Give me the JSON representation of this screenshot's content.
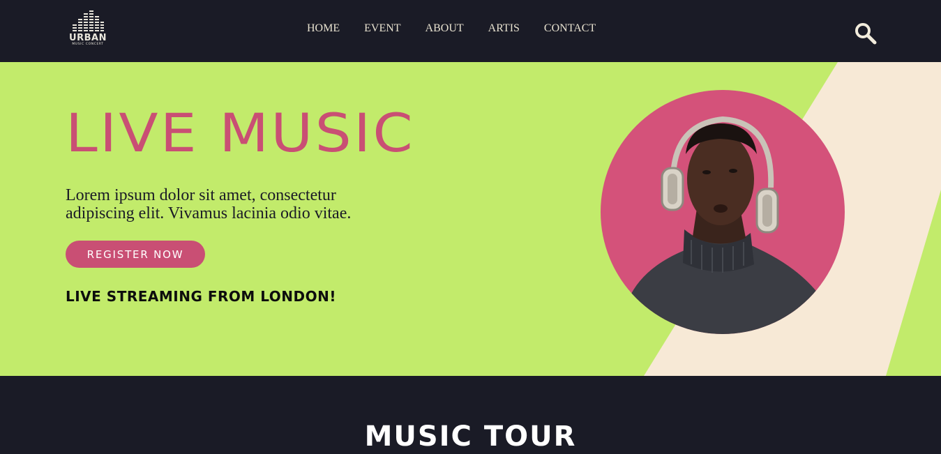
{
  "header": {
    "logo": {
      "name": "URBAN",
      "tagline": "MUSIC CONCERT"
    },
    "nav": [
      {
        "label": "HOME"
      },
      {
        "label": "EVENT"
      },
      {
        "label": "ABOUT"
      },
      {
        "label": "ARTIS"
      },
      {
        "label": "CONTACT"
      }
    ],
    "search_icon": "search-icon"
  },
  "hero": {
    "title": "LIVE MUSIC",
    "description": "Lorem ipsum dolor sit amet, consectetur adipiscing elit. Vivamus lacinia odio vitae.",
    "cta_label": "REGISTER NOW",
    "streaming_text": "LIVE STREAMING FROM LONDON!"
  },
  "tour": {
    "title": "MUSIC TOUR"
  },
  "colors": {
    "navbar_bg": "#1a1b26",
    "hero_bg": "#c2eb6b",
    "accent_pink": "#c94f74",
    "stripe_cream": "#f7e9d6",
    "photo_circle": "#d4527a",
    "nav_text": "#e8e2d0"
  }
}
